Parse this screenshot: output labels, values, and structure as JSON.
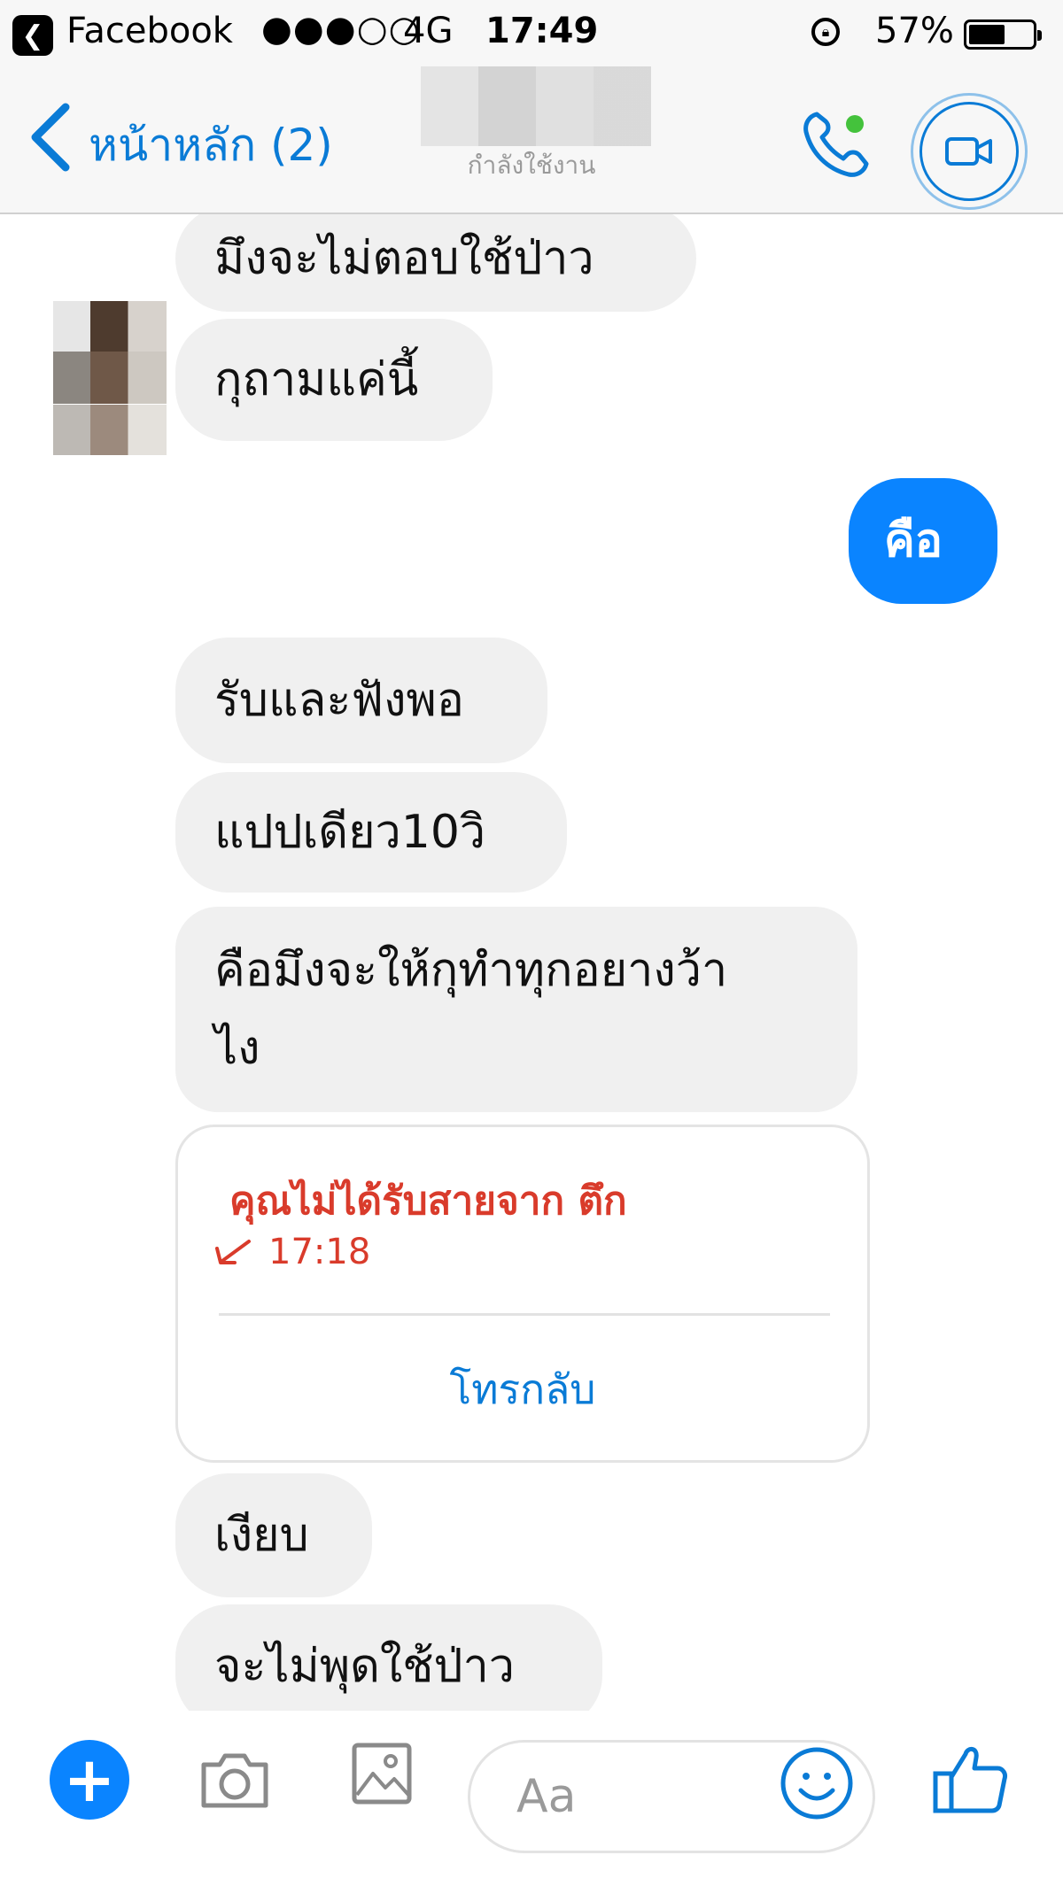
{
  "status_bar": {
    "app_name": "Facebook",
    "signal": "●●●○○",
    "network": "4G",
    "time": "17:49",
    "battery_percent": "57%",
    "battery_level": 0.57
  },
  "nav": {
    "back_label": "หน้าหลัก (2)",
    "subtitle": "กำลังใช้งาน"
  },
  "messages": [
    {
      "text": "มึงจะไม่ตอบใช้ป่าว",
      "direction": "incoming"
    },
    {
      "text": "กุถามแค่นี้",
      "direction": "incoming"
    },
    {
      "text": "คือ",
      "direction": "outgoing"
    },
    {
      "text": "รับและฟังพอ",
      "direction": "incoming"
    },
    {
      "text": "แปปเดียว10วิ",
      "direction": "incoming"
    },
    {
      "text": "คือมึงจะให้กุทำทุกอยางว้า\nไง",
      "direction": "incoming"
    },
    {
      "text": "เงียบ",
      "direction": "incoming"
    },
    {
      "text": "จะไม่พุดใช้ป่าว",
      "direction": "incoming"
    }
  ],
  "missed_call": {
    "text": "คุณไม่ได้รับสายจาก ตึก",
    "time": "17:18",
    "callback_label": "โทรกลับ"
  },
  "composer": {
    "placeholder": "Aa"
  },
  "colors": {
    "accent": "#0a84ff",
    "link": "#0a7bd6",
    "missed": "#d93b2b",
    "bubble_in": "#f0f0f0",
    "online_dot": "#44c23c"
  }
}
